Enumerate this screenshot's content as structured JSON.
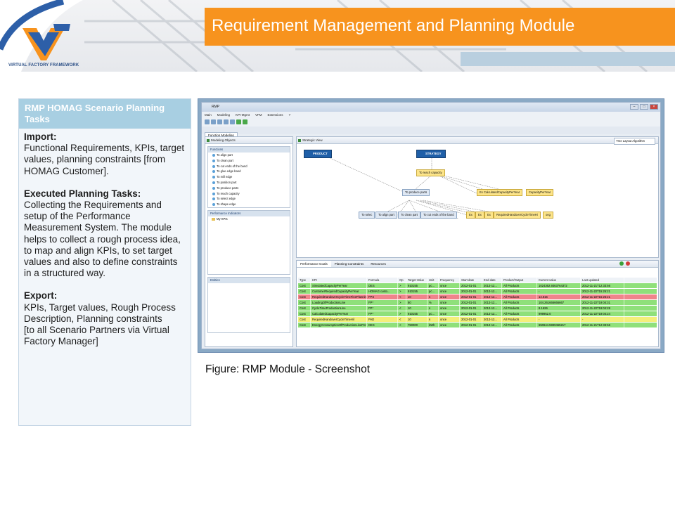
{
  "header": {
    "logo_text": "VIRTUAL FACTORY FRAMEWORK",
    "title": "Requirement Management and Planning Module"
  },
  "left_panel": {
    "heading": "RMP HOMAG Scenario Planning Tasks",
    "import_label": "Import:",
    "import_text": "Functional Requirements, KPIs, target values, planning constraints [from HOMAG Customer].",
    "executed_label": "Executed Planning Tasks:",
    "executed_text": "Collecting the Requirements and setup of the Performance Measurement System. The module helps to collect a rough process idea, to map and align KPIs, to set target values and also to define constraints in a structured way.",
    "export_label": "Export:",
    "export_text": "KPIs, Target values, Rough Process Description, Planning constraints",
    "export_text2": "[to all Scenario Partners via Virtual Factory Manager]"
  },
  "app": {
    "window_title": "RMP",
    "menu": [
      "Main",
      "Modeling",
      "KPI-Mgmt",
      "VFM",
      "Extensions",
      "?"
    ],
    "perspective": "Function Modeling",
    "modeling_objects_tab": "Modeling Objects",
    "functions_header": "Functions",
    "functions": [
      "To align part",
      "To clean part",
      "To cut ends of the band",
      "To glue edge band",
      "To mill edge",
      "To position part",
      "To produce parts",
      "To reach capacity",
      "To select edge",
      "To shape edge"
    ],
    "performance_indicators_header": "Performance Indicators",
    "kpi_folder": "My KPIs",
    "entities_header": "Entities",
    "strategic_view_tab": "Strategic View",
    "layout_select": "Tree Layout Algorithm",
    "graph": {
      "product": "PRODUCT",
      "strategy": "STRATEGY",
      "reach": "To reach capacity",
      "produce": "To produce parts",
      "kpi_calc": "Ex CalculatedCapacityPerYear",
      "kpi_cap": "CapacityPerYear",
      "leaves": [
        "To selec",
        "To align part",
        "To clean part",
        "To cut ends of the band",
        "Ex",
        "Ex",
        "Ex",
        "RequiredHandoverCycleTimeHi",
        "ong"
      ]
    },
    "bottom_tabs": [
      "Performance Goals",
      "Planning Constraints",
      "Resources"
    ],
    "table": {
      "headers": [
        "Type",
        "KPI",
        "Formula",
        "Op",
        "Target Value",
        "Unit",
        "Frequency",
        "Start date",
        "End date",
        "Product/Output",
        "Current value",
        "Last updated"
      ],
      "rows": [
        {
          "status": "g",
          "cells": [
            "Cost",
            "SimulatedCapacityPerYear",
            "DES",
            ">",
            "910155",
            "pc...",
            "once",
            "2012-01-01",
            "2013-12...",
            "All Products",
            "1024362.9363764372",
            "2012-11-21T12:33:56"
          ]
        },
        {
          "status": "g",
          "cells": [
            "Cost",
            "CustomerRequiredCapacityPerYear",
            "HOMAG custo...",
            ">",
            "910155",
            "pc...",
            "once",
            "2012-01-01",
            "2013-12...",
            "All Products",
            "-",
            "2012-11-22T15:25:21"
          ]
        },
        {
          "status": "r",
          "cells": [
            "Cost",
            "RequiredHandoverCycleTimeFinePlanning",
            "FPS",
            "<",
            "10",
            "s",
            "once",
            "2012-01-01",
            "2013-12...",
            "All Products",
            "14.615",
            "2012-11-22T15:25:21"
          ]
        },
        {
          "status": "g",
          "cells": [
            "Cost",
            "LoadingOfProductionLine",
            "FP*",
            ">",
            "80",
            "%",
            "once",
            "2012-01-01",
            "2013-12...",
            "All Products",
            "104.261666666667",
            "2012-11-22T19:04:31"
          ]
        },
        {
          "status": "g",
          "cells": [
            "Cost",
            "CycleTimeProductionLine",
            "FP*",
            "<",
            "10",
            "s",
            "once",
            "2012-01-01",
            "2013-12...",
            "All Products",
            "8.1626",
            "2012-11-22T19:04:28"
          ]
        },
        {
          "status": "g",
          "cells": [
            "Cost",
            "CalculatedCapacityPerYear",
            "FP*",
            ">",
            "910155",
            "pc...",
            "once",
            "2012-01-01",
            "2013-12...",
            "All Products",
            "999952.0",
            "2012-11-22T19:04:24"
          ]
        },
        {
          "status": "yl",
          "cells": [
            "Cost",
            "RequiredHandoverCycleTimeHil",
            "PAD",
            "<",
            "10",
            "s",
            "once",
            "2012-01-01",
            "2013-12...",
            "All Products",
            "-",
            "-"
          ]
        },
        {
          "status": "g",
          "cells": [
            "Cost",
            "EnergyConsumptionOfProductionLinePerY...",
            "DES",
            "<",
            "750000",
            "kWh",
            "once",
            "2012-01-01",
            "2013-12...",
            "All Products",
            "650644.5999465217",
            "2012-11-21T12:33:56"
          ]
        }
      ]
    }
  },
  "caption": "Figure: RMP Module - Screenshot"
}
